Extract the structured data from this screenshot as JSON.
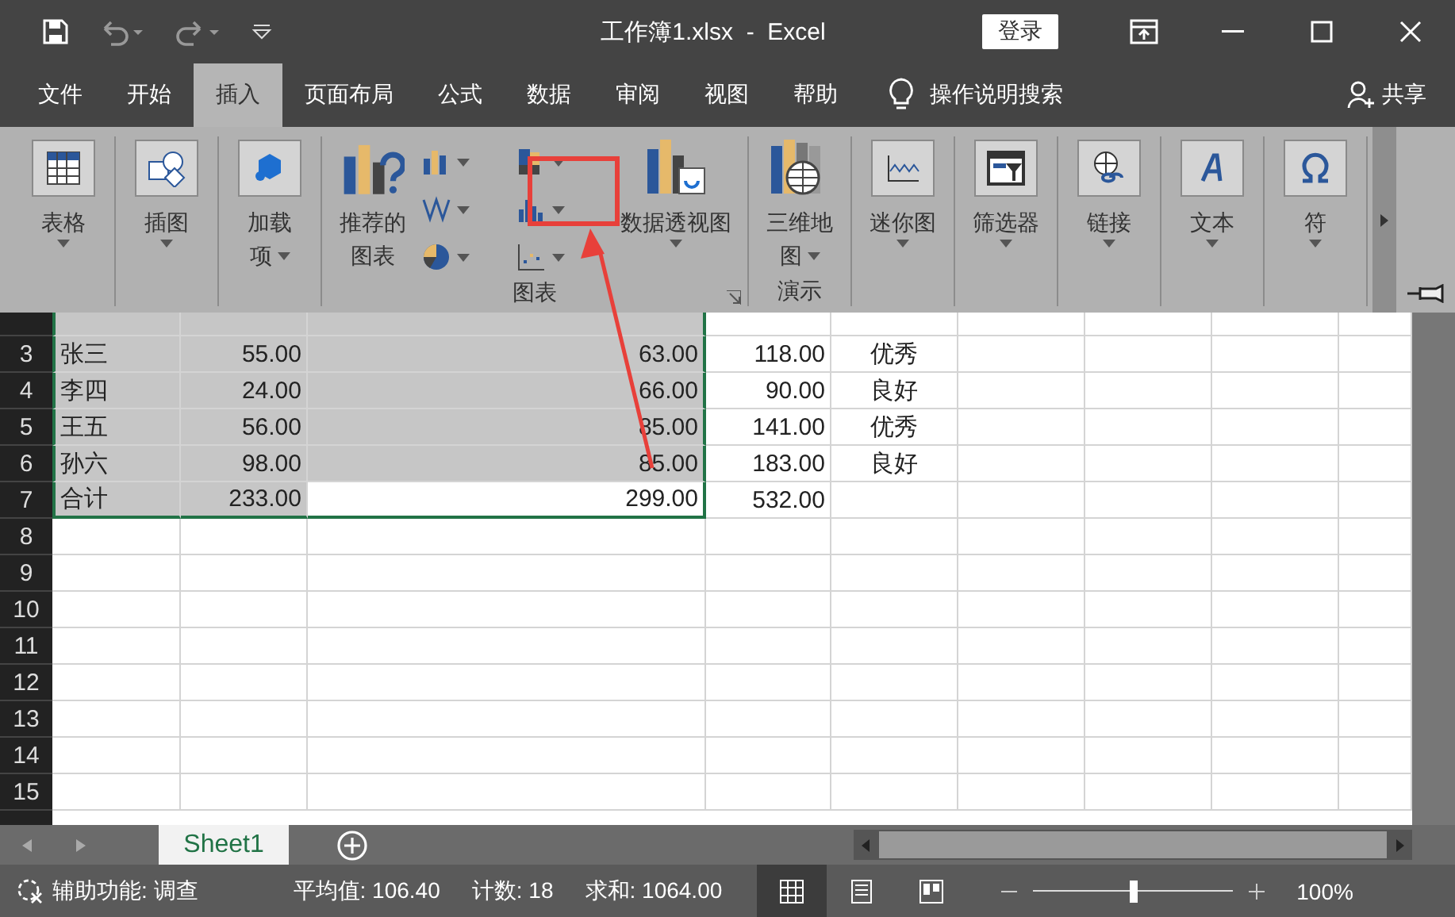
{
  "window": {
    "title": "工作簿1.xlsx  -  Excel",
    "login": "登录"
  },
  "menu_tabs": [
    {
      "label": "文件",
      "selected": false
    },
    {
      "label": "开始",
      "selected": false
    },
    {
      "label": "插入",
      "selected": true
    },
    {
      "label": "页面布局",
      "selected": false
    },
    {
      "label": "公式",
      "selected": false
    },
    {
      "label": "数据",
      "selected": false
    },
    {
      "label": "审阅",
      "selected": false
    },
    {
      "label": "视图",
      "selected": false
    },
    {
      "label": "帮助",
      "selected": false
    }
  ],
  "tell_me": "操作说明搜索",
  "share": "共享",
  "ribbon": {
    "groups": [
      {
        "buttons": [
          {
            "kind": "table",
            "lines": [
              "表格"
            ],
            "dropdown": true
          }
        ]
      },
      {
        "buttons": [
          {
            "kind": "shapes",
            "lines": [
              "插图"
            ],
            "dropdown": true
          }
        ]
      },
      {
        "buttons": [
          {
            "kind": "addin",
            "lines": [
              "加载",
              "项"
            ],
            "dropdown": true
          }
        ]
      },
      {
        "label": "图表",
        "launcher": true,
        "buttons": [
          {
            "kind": "recommended",
            "lines": [
              "推荐的",
              "图表"
            ],
            "dropdown": false
          },
          {
            "kind": "gallery"
          },
          {
            "kind": "pivot",
            "lines": [
              "数据透视图"
            ],
            "dropdown": true
          }
        ]
      },
      {
        "label": "演示",
        "buttons": [
          {
            "kind": "map",
            "lines": [
              "三维地",
              "图"
            ],
            "dropdown": true
          }
        ]
      },
      {
        "buttons": [
          {
            "kind": "sparkline",
            "lines": [
              "迷你图"
            ],
            "dropdown": true
          }
        ]
      },
      {
        "buttons": [
          {
            "kind": "filter",
            "lines": [
              "筛选器"
            ],
            "dropdown": true
          }
        ]
      },
      {
        "buttons": [
          {
            "kind": "link",
            "lines": [
              "链接"
            ],
            "dropdown": true
          }
        ]
      },
      {
        "buttons": [
          {
            "kind": "text",
            "lines": [
              "文本"
            ],
            "dropdown": true
          }
        ]
      },
      {
        "buttons": [
          {
            "kind": "symbol",
            "lines": [
              "符"
            ],
            "dropdown": true
          }
        ]
      }
    ]
  },
  "sheet": {
    "rows": [
      {
        "number": "3",
        "cells": [
          {
            "text": "张三",
            "kind": "label",
            "selected": true
          },
          {
            "text": "55.00",
            "kind": "number",
            "selected": true
          },
          {
            "text": "63.00",
            "kind": "number",
            "selected": true
          },
          {
            "text": "118.00",
            "kind": "number",
            "selected": false
          },
          {
            "text": "优秀",
            "kind": "tag",
            "selected": false
          }
        ]
      },
      {
        "number": "4",
        "cells": [
          {
            "text": "李四",
            "kind": "label",
            "selected": true
          },
          {
            "text": "24.00",
            "kind": "number",
            "selected": true
          },
          {
            "text": "66.00",
            "kind": "number",
            "selected": true
          },
          {
            "text": "90.00",
            "kind": "number",
            "selected": false
          },
          {
            "text": "良好",
            "kind": "tag",
            "selected": false
          }
        ]
      },
      {
        "number": "5",
        "cells": [
          {
            "text": "王五",
            "kind": "label",
            "selected": true
          },
          {
            "text": "56.00",
            "kind": "number",
            "selected": true
          },
          {
            "text": "85.00",
            "kind": "number",
            "selected": true
          },
          {
            "text": "141.00",
            "kind": "number",
            "selected": false
          },
          {
            "text": "优秀",
            "kind": "tag",
            "selected": false
          }
        ]
      },
      {
        "number": "6",
        "cells": [
          {
            "text": "孙六",
            "kind": "label",
            "selected": true
          },
          {
            "text": "98.00",
            "kind": "number",
            "selected": true
          },
          {
            "text": "85.00",
            "kind": "number",
            "selected": true
          },
          {
            "text": "183.00",
            "kind": "number",
            "selected": false
          },
          {
            "text": "良好",
            "kind": "tag",
            "selected": false
          }
        ]
      },
      {
        "number": "7",
        "cells": [
          {
            "text": "合计",
            "kind": "label",
            "selected": true
          },
          {
            "text": "233.00",
            "kind": "number",
            "selected": true
          },
          {
            "text": "299.00",
            "kind": "number",
            "selected": false,
            "active": true
          },
          {
            "text": "532.00",
            "kind": "number",
            "selected": false
          }
        ]
      },
      {
        "number": "8",
        "cells": []
      },
      {
        "number": "9",
        "cells": []
      },
      {
        "number": "10",
        "cells": []
      },
      {
        "number": "11",
        "cells": []
      },
      {
        "number": "12",
        "cells": []
      },
      {
        "number": "13",
        "cells": []
      },
      {
        "number": "14",
        "cells": []
      },
      {
        "number": "15",
        "cells": []
      }
    ]
  },
  "sheet_tabs": [
    {
      "label": "Sheet1",
      "selected": true
    }
  ],
  "status_bar": {
    "accessibility": "辅助功能: 调查",
    "average": "平均值: 106.40",
    "count": "计数: 18",
    "sum": "求和: 1064.00",
    "views": [
      {
        "kind": "normal",
        "selected": true
      },
      {
        "kind": "layout",
        "selected": false
      },
      {
        "kind": "pagebreak",
        "selected": false
      }
    ],
    "zoom": {
      "level": 0.5,
      "reading": "100%"
    }
  }
}
